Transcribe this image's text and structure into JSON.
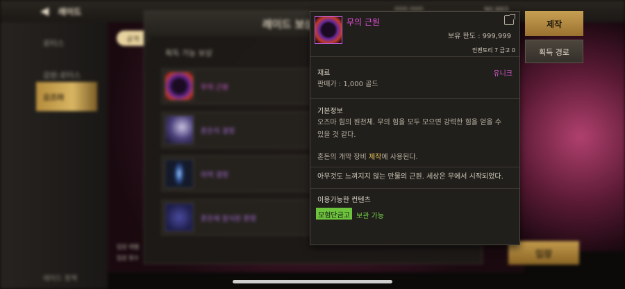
{
  "topbar": {
    "back_icon": "arrow-left-icon",
    "title": "레이드",
    "res1": "000,000",
    "res2": "90,993"
  },
  "sidebar": {
    "items": [
      {
        "label": "로터스",
        "active": false
      },
      {
        "label": "감원:로터스",
        "active": false
      },
      {
        "label": "오즈마",
        "active": true
      }
    ],
    "bottom_label": "레이드 정책"
  },
  "main": {
    "chip_label": "공격",
    "bottom_line1": "입장 레벨",
    "bottom_line2": "입장 횟수",
    "enter_label": "입장"
  },
  "reward_panel": {
    "title": "레이드 보상",
    "section_label": "획득 가능 보상",
    "rewards": [
      {
        "name": "무의 근원",
        "color": "#d35ad0"
      },
      {
        "name": "혼돈의 결정",
        "color": "#a36ad0"
      },
      {
        "name": "마력 결정",
        "color": "#a36ad0"
      },
      {
        "name": "혼돈에 잠식된 환영",
        "color": "#a36ad0"
      }
    ]
  },
  "tooltip": {
    "item_name": "무의 근원",
    "icon": "void-orb-icon",
    "share_icon": "share-icon",
    "limit": "보유 한도 : 999,999",
    "inventory": "인벤토리 7 금고 0",
    "category": "재료",
    "rarity": "유니크",
    "price": "판매가 : 1,000 골드",
    "basic_info_label": "기본정보",
    "desc_line1": "오즈마 힘의 원천체. 무의 힘을 모두 모으면 강력한 힘을 얻을 수",
    "desc_line2": "있을 것 같다.",
    "usage_pre": "혼돈의 개막 장비 ",
    "usage_hl": "제작",
    "usage_post": "에 사용된다.",
    "flavor": "아무것도 느껴지지 않는 만물의 근원. 세상은 무에서 시작되었다.",
    "contents_label": "이용가능한 컨텐츠",
    "badge": "모험단금고",
    "storage": "보관 가능"
  },
  "buttons": {
    "make": "제작",
    "route": "획득 경로"
  },
  "colors": {
    "epic_name": "#e24fd8",
    "gold": "#c79f52",
    "green": "#6ec33c"
  }
}
